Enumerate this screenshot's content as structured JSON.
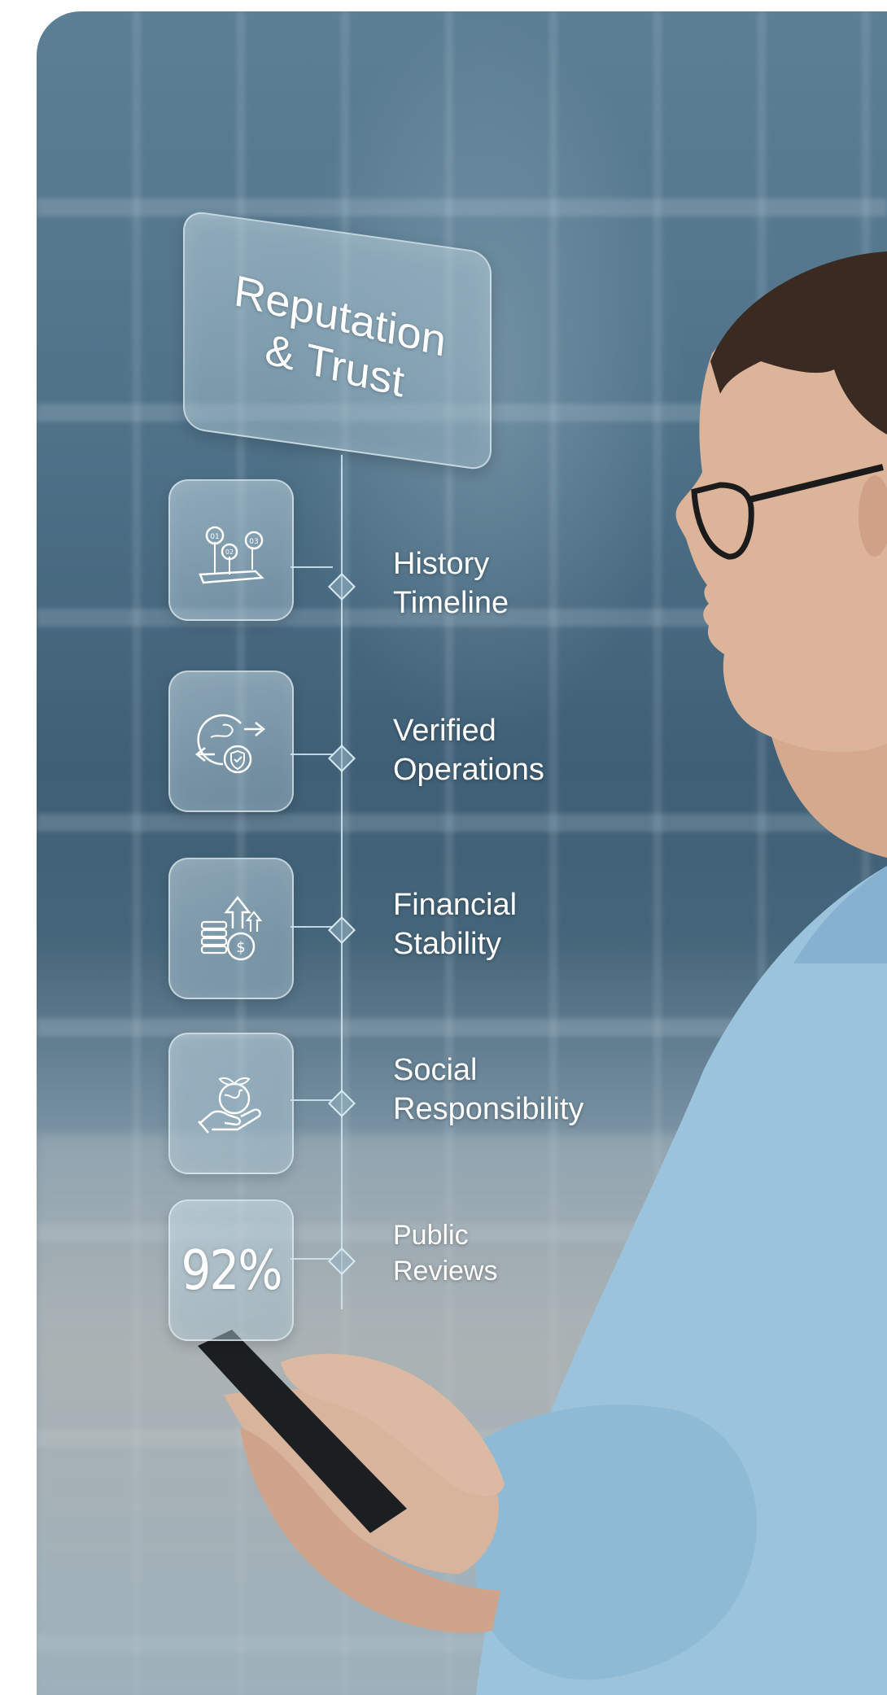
{
  "header": {
    "title": "Reputation\n& Trust"
  },
  "items": [
    {
      "label": "History\nTimeline",
      "icon": "history-milestones-icon"
    },
    {
      "label": "Verified\nOperations",
      "icon": "verified-globe-shield-icon"
    },
    {
      "label": "Financial\nStability",
      "icon": "coins-growth-icon"
    },
    {
      "label": "Social\nResponsibility",
      "icon": "hand-globe-plant-icon"
    },
    {
      "label": "Public\nReviews",
      "tile_value": "92%"
    }
  ],
  "colors": {
    "accent_line": "#cde4f0",
    "text": "#ffffff",
    "sweater": "#9cc3dc"
  },
  "history_icon_marks": [
    "01",
    "02",
    "03"
  ]
}
